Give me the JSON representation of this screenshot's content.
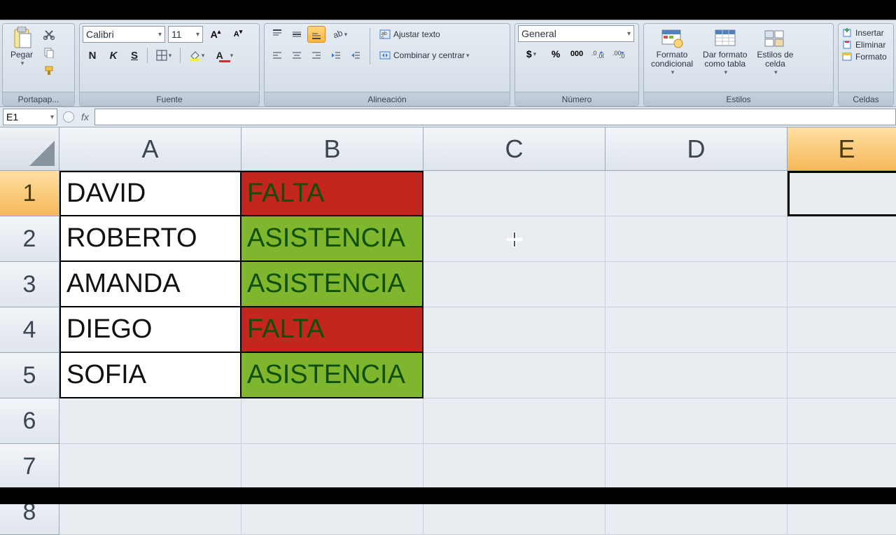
{
  "ribbon": {
    "clipboard": {
      "title": "Portapap...",
      "paste": "Pegar"
    },
    "font": {
      "title": "Fuente",
      "name": "Calibri",
      "size": "11"
    },
    "align": {
      "title": "Alineación",
      "wrap": "Ajustar texto",
      "merge": "Combinar y centrar"
    },
    "number": {
      "title": "Número",
      "format": "General",
      "thousands": "000"
    },
    "styles": {
      "title": "Estilos",
      "cond": "Formato\ncondicional",
      "table": "Dar formato\ncomo tabla",
      "cell": "Estilos de\ncelda"
    },
    "cells": {
      "title": "Celdas",
      "insert": "Insertar",
      "delete": "Eliminar",
      "format": "Formato"
    }
  },
  "namebox": "E1",
  "columns": [
    "A",
    "B",
    "C",
    "D",
    "E"
  ],
  "rows_visible": 8,
  "selected_cell_col": "E",
  "selected_cell_row": 1,
  "data_rows": [
    {
      "name": "DAVID",
      "status": "FALTA",
      "status_kind": "red"
    },
    {
      "name": "ROBERTO",
      "status": "ASISTENCIA",
      "status_kind": "green"
    },
    {
      "name": "AMANDA",
      "status": "ASISTENCIA",
      "status_kind": "green"
    },
    {
      "name": "DIEGO",
      "status": "FALTA",
      "status_kind": "red"
    },
    {
      "name": "SOFIA",
      "status": "ASISTENCIA",
      "status_kind": "green"
    }
  ],
  "colors": {
    "red": "#c3261c",
    "green": "#7fb62d"
  }
}
